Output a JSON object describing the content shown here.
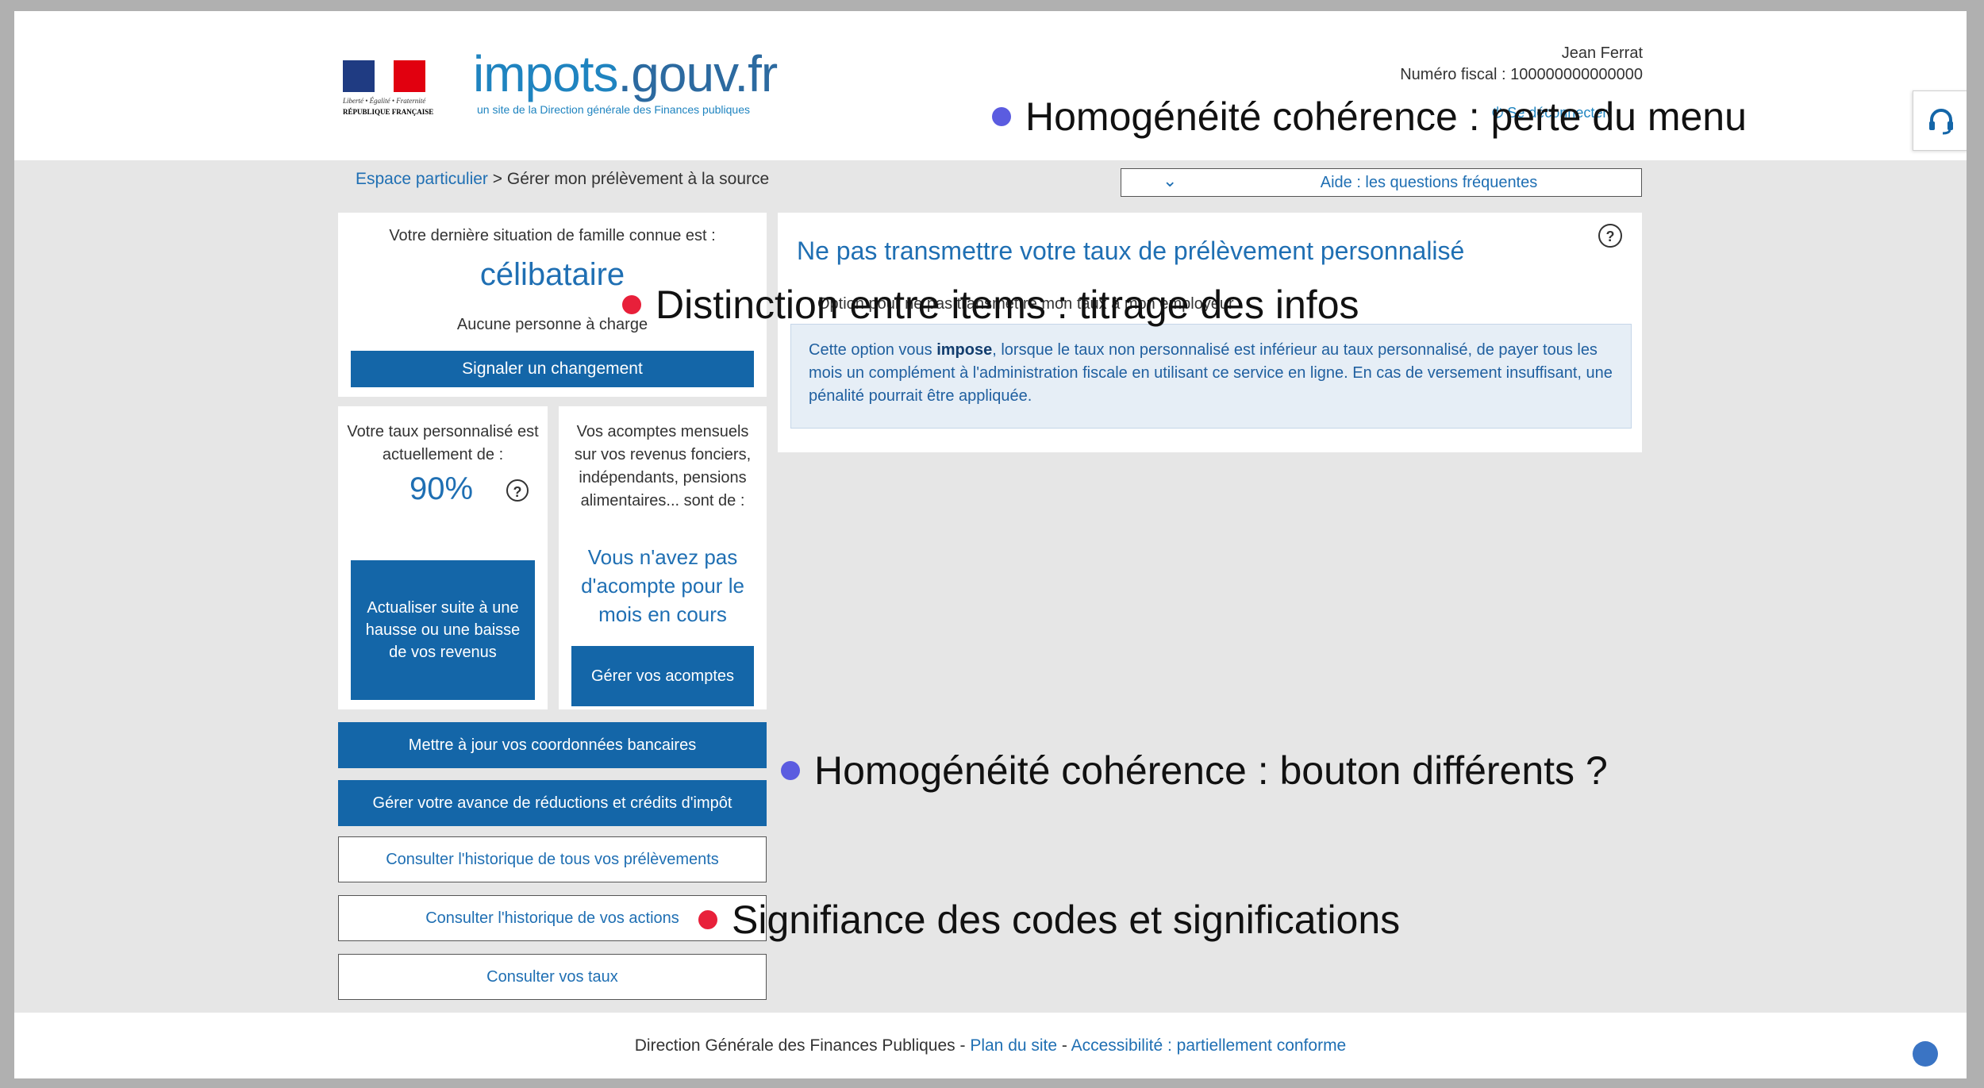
{
  "header": {
    "republic_motto": "Liberté • Égalité • Fraternité",
    "republic_name": "RÉPUBLIQUE FRANÇAISE",
    "brand_name": "impots",
    "brand_suffix": ".gouv.fr",
    "brand_subtitle": "un site de la Direction générale des Finances publiques",
    "user_name": "Jean Ferrat",
    "fiscal_number": "Numéro fiscal : 100000000000000",
    "logout_label": "Se déconnecter"
  },
  "breadcrumb": {
    "home": "Espace particulier",
    "separator": ">",
    "current": "Gérer mon prélèvement à la source"
  },
  "help_bar": {
    "label": "Aide : les questions fréquentes"
  },
  "family_card": {
    "label": "Votre dernière situation de famille connue est :",
    "value": "célibataire",
    "dependents": "Aucune personne à charge",
    "button": "Signaler un changement"
  },
  "rate_card": {
    "label": "Votre taux personnalisé est actuellement de :",
    "value": "90%",
    "help": "?",
    "button": "Actualiser suite à une hausse ou une baisse de vos revenus"
  },
  "acompte_card": {
    "label": "Vos acomptes mensuels sur vos revenus fonciers, indépendants, pensions alimentaires... sont de :",
    "value": "Vous n'avez pas d'acompte pour le mois en cours",
    "button": "Gérer vos acomptes"
  },
  "actions": [
    "Mettre à jour vos coordonnées bancaires",
    "Gérer votre avance de réductions et crédits d'impôt",
    "Consulter l'historique de tous vos prélèvements",
    "Consulter l'historique de vos actions",
    "Consulter vos taux"
  ],
  "main_card": {
    "title": "Ne pas transmettre votre taux de prélèvement personnalisé",
    "help": "?",
    "subtitle": "Option pour ne pas transmettre mon taux à mon employeur",
    "info_prefix": "Cette option vous ",
    "info_bold": "impose",
    "info_rest": ", lorsque le taux non personnalisé est inférieur au taux personnalisé, de payer tous les mois un complément à l'administration fiscale en utilisant ce service en ligne. En cas de versement insuffisant, une pénalité pourrait être appliquée."
  },
  "footer": {
    "org": "Direction Générale des Finances Publiques",
    "sep": " - ",
    "site_map": "Plan du site",
    "accessibility": "Accessibilité : partiellement conforme"
  },
  "annotations": [
    {
      "text": "Homogénéité cohérence : perte du menu",
      "color": "#5b5ce0"
    },
    {
      "text": "Distinction entre items : titrage des infos",
      "color": "#e8203a"
    },
    {
      "text": "Homogénéité cohérence : bouton différents ?",
      "color": "#5b5ce0"
    },
    {
      "text": "Signifiance des codes et significations",
      "color": "#e8203a"
    }
  ],
  "colors": {
    "primary_blue": "#1466a8",
    "link_blue": "#1f6fb3",
    "info_bg": "#e6eef6",
    "annotation_blue": "#5b5ce0",
    "annotation_red": "#e8203a"
  }
}
